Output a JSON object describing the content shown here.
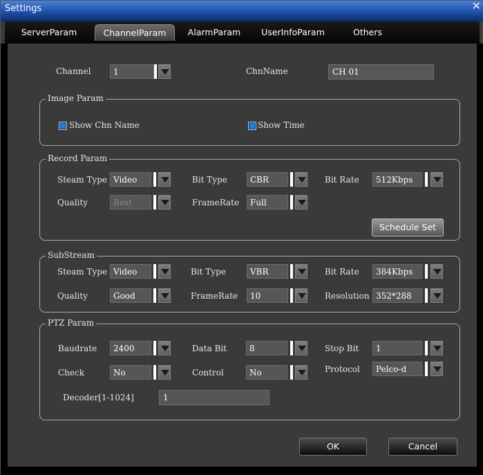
{
  "window": {
    "title": "Settings",
    "close_symbol": "✕"
  },
  "tabs": [
    {
      "label": "ServerParam"
    },
    {
      "label": "ChannelParam"
    },
    {
      "label": "AlarmParam"
    },
    {
      "label": "UserInfoParam"
    },
    {
      "label": "Others"
    }
  ],
  "active_tab": "ChannelParam",
  "channel": {
    "channel_label": "Channel",
    "channel_value": "1",
    "chnname_label": "ChnName",
    "chnname_value": "CH 01"
  },
  "image_param": {
    "title": "Image Param",
    "show_chn_name": "Show Chn Name",
    "show_time": "Show Time"
  },
  "record_param": {
    "title": "Record Param",
    "steam_type_label": "Steam Type",
    "steam_type_value": "Video",
    "bit_type_label": "Bit Type",
    "bit_type_value": "CBR",
    "bit_rate_label": "Bit Rate",
    "bit_rate_value": "512Kbps",
    "quality_label": "Quality",
    "quality_value": "Best",
    "framerate_label": "FrameRate",
    "framerate_value": "Full",
    "schedule_button": "Schedule Set"
  },
  "substream": {
    "title": "SubStream",
    "steam_type_label": "Steam Type",
    "steam_type_value": "Video",
    "bit_type_label": "Bit Type",
    "bit_type_value": "VBR",
    "bit_rate_label": "Bit Rate",
    "bit_rate_value": "384Kbps",
    "quality_label": "Quality",
    "quality_value": "Good",
    "framerate_label": "FrameRate",
    "framerate_value": "10",
    "resolution_label": "Resolution",
    "resolution_value": "352*288"
  },
  "ptz_param": {
    "title": "PTZ Param",
    "baudrate_label": "Baudrate",
    "baudrate_value": "2400",
    "data_bit_label": "Data Bit",
    "data_bit_value": "8",
    "stop_bit_label": "Stop Bit",
    "stop_bit_value": "1",
    "check_label": "Check",
    "check_value": "No",
    "control_label": "Control",
    "control_value": "No",
    "protocol_label": "Protocol",
    "protocol_value": "Pelco-d",
    "decoder_label": "Decoder[1-1024]",
    "decoder_value": "1"
  },
  "footer": {
    "ok": "OK",
    "cancel": "Cancel"
  },
  "colors": {
    "title_bar": "#1f4fa8",
    "background": "#3a3a3a",
    "checkbox": "#1a7fe0"
  }
}
